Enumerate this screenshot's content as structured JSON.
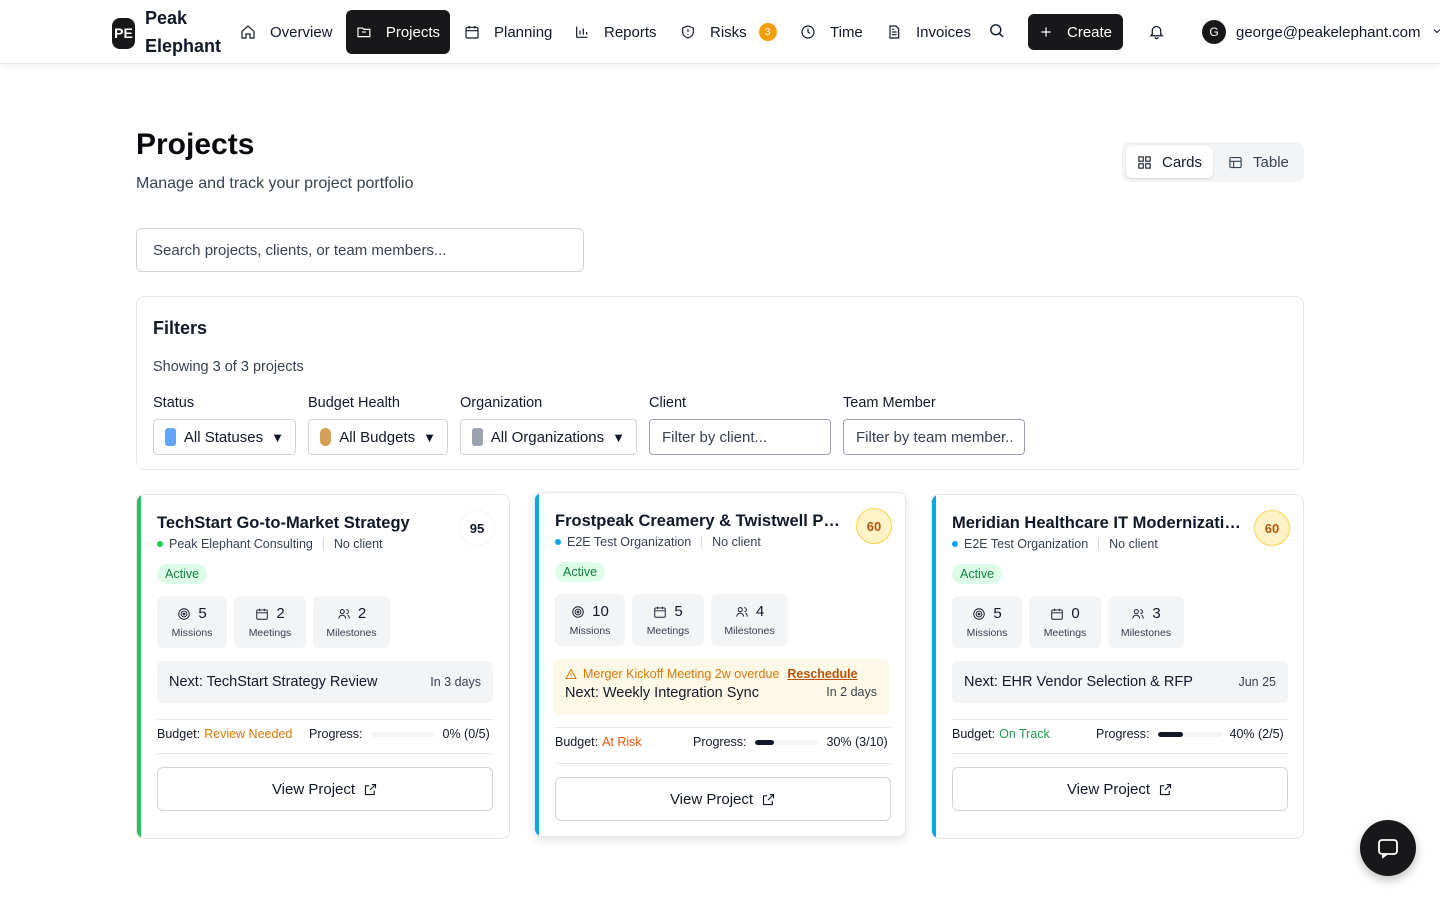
{
  "brand": {
    "logo": "PE",
    "name": "Peak Elephant"
  },
  "nav": {
    "items": [
      {
        "label": "Overview",
        "icon": "home-icon"
      },
      {
        "label": "Projects",
        "icon": "folder-icon",
        "active": true
      },
      {
        "label": "Planning",
        "icon": "calendar-icon"
      },
      {
        "label": "Reports",
        "icon": "bar-chart-icon"
      },
      {
        "label": "Risks",
        "icon": "shield-icon",
        "badge": "3"
      },
      {
        "label": "Time",
        "icon": "clock-icon"
      },
      {
        "label": "Invoices",
        "icon": "file-icon"
      }
    ],
    "create_label": "Create",
    "user_initial": "G",
    "user_email": "george@peakelephant.com"
  },
  "header": {
    "title": "Projects",
    "subtitle": "Manage and track your project portfolio",
    "view_cards": "Cards",
    "view_table": "Table",
    "search_placeholder": "Search projects, clients, or team members..."
  },
  "filters": {
    "title": "Filters",
    "count": "Showing 3 of 3 projects",
    "status_label": "Status",
    "status_value": "All Statuses",
    "budget_label": "Budget Health",
    "budget_value": "All Budgets",
    "org_label": "Organization",
    "org_value": "All Organizations",
    "client_label": "Client",
    "client_placeholder": "Filter by client...",
    "team_label": "Team Member",
    "team_placeholder": "Filter by team member...",
    "caret": "▼"
  },
  "projects": [
    {
      "title": "TechStart Go-to-Market Strategy",
      "score": "95",
      "org": "Peak Elephant Consulting",
      "client": "No client",
      "status": "Active",
      "missions": "5",
      "missions_label": "Missions",
      "meetings": "2",
      "meetings_label": "Meetings",
      "milestones": "2",
      "milestones_label": "Milestones",
      "next": "Next: TechStart Strategy Review",
      "next_when": "In 3 days",
      "budget_label": "Budget:",
      "budget_value": "Review Needed",
      "progress_label": "Progress:",
      "progress_text": "0% (0/5)",
      "progress": 0,
      "view_label": "View Project",
      "accent": "#22c55e",
      "dot": "#22c55e",
      "budget_color": "#d97706"
    },
    {
      "title": "Frostpeak Creamery & Twistwell Pr...",
      "score": "60",
      "org": "E2E Test Organization",
      "client": "No client",
      "status": "Active",
      "missions": "10",
      "missions_label": "Missions",
      "meetings": "5",
      "meetings_label": "Meetings",
      "milestones": "4",
      "milestones_label": "Milestones",
      "alert": "Merger Kickoff Meeting 2w overdue",
      "alert_action": "Reschedule",
      "next": "Next: Weekly Integration Sync",
      "next_when": "In 2 days",
      "budget_label": "Budget:",
      "budget_value": "At Risk",
      "progress_label": "Progress:",
      "progress_text": "30% (3/10)",
      "progress": 0.3,
      "view_label": "View Project",
      "accent": "#0ea5e9",
      "dot": "#0ea5e9",
      "budget_color": "#ea580c"
    },
    {
      "title": "Meridian Healthcare IT Modernization",
      "score": "60",
      "org": "E2E Test Organization",
      "client": "No client",
      "status": "Active",
      "missions": "5",
      "missions_label": "Missions",
      "meetings": "0",
      "meetings_label": "Meetings",
      "milestones": "3",
      "milestones_label": "Milestones",
      "next": "Next: EHR Vendor Selection & RFP",
      "next_when": "Jun 25",
      "budget_label": "Budget:",
      "budget_value": "On Track",
      "progress_label": "Progress:",
      "progress_text": "40% (2/5)",
      "progress": 0.4,
      "view_label": "View Project",
      "accent": "#0ea5e9",
      "dot": "#0ea5e9",
      "budget_color": "#16a34a"
    }
  ]
}
